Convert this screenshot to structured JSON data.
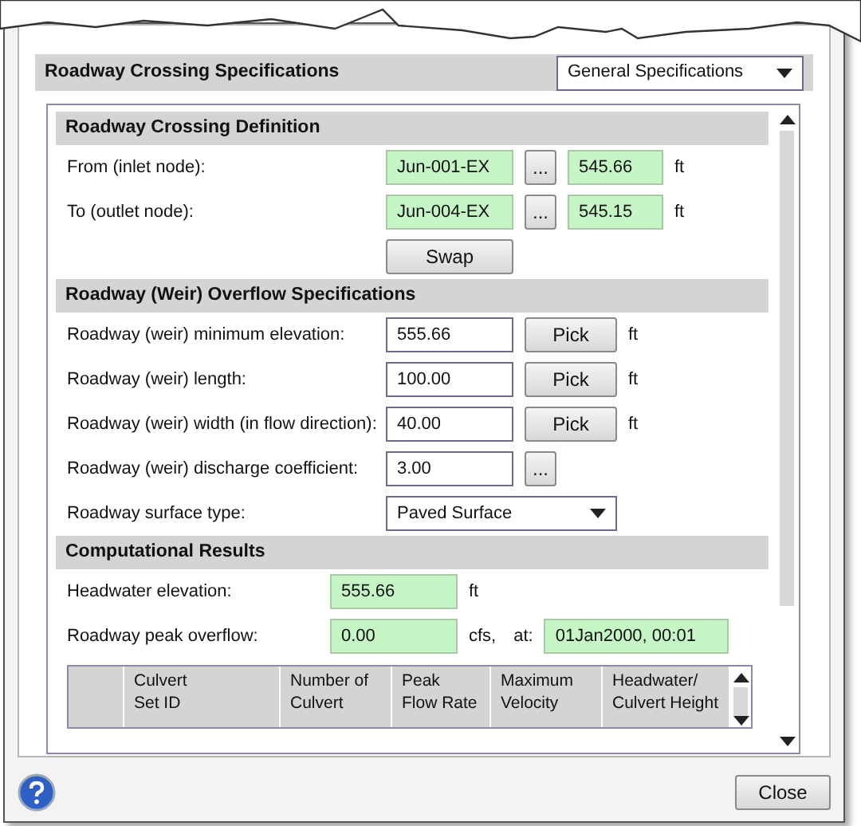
{
  "header": {
    "title": "Roadway Crossing Specifications",
    "view_select": "General Specifications"
  },
  "sections": [
    {
      "title": "Roadway Crossing Definition",
      "rows": [
        {
          "kind": "node",
          "label": "From (inlet node):",
          "node": "Jun-001-EX",
          "browse": "...",
          "elevation": "545.66",
          "unit": "ft"
        },
        {
          "kind": "node",
          "label": "To (outlet node):",
          "node": "Jun-004-EX",
          "browse": "...",
          "elevation": "545.15",
          "unit": "ft"
        },
        {
          "kind": "button",
          "button": "Swap"
        }
      ]
    },
    {
      "title": "Roadway (Weir) Overflow Specifications",
      "rows": [
        {
          "kind": "pick",
          "label": "Roadway (weir) minimum elevation:",
          "value": "555.66",
          "button": "Pick",
          "unit": "ft"
        },
        {
          "kind": "pick",
          "label": "Roadway (weir) length:",
          "value": "100.00",
          "button": "Pick",
          "unit": "ft"
        },
        {
          "kind": "pick",
          "label": "Roadway (weir) width (in flow direction):",
          "value": "40.00",
          "button": "Pick",
          "unit": "ft"
        },
        {
          "kind": "browse",
          "label": "Roadway (weir) discharge coefficient:",
          "value": "3.00",
          "button": "..."
        },
        {
          "kind": "select",
          "label": "Roadway surface type:",
          "value": "Paved Surface"
        }
      ]
    },
    {
      "title": "Computational Results",
      "rows": [
        {
          "kind": "result",
          "label": "Headwater elevation:",
          "value": "555.66",
          "unit": "ft"
        },
        {
          "kind": "result_time",
          "label": "Roadway peak overflow:",
          "value": "0.00",
          "unit": "cfs,",
          "at_label": "at:",
          "time": "01Jan2000, 00:01"
        }
      ]
    }
  ],
  "table": {
    "columns": [
      "",
      "Culvert\nSet ID",
      "Number of\nCulvert",
      "Peak\nFlow Rate",
      "Maximum\nVelocity",
      "Headwater/\nCulvert Height"
    ]
  },
  "footer": {
    "close": "Close"
  }
}
